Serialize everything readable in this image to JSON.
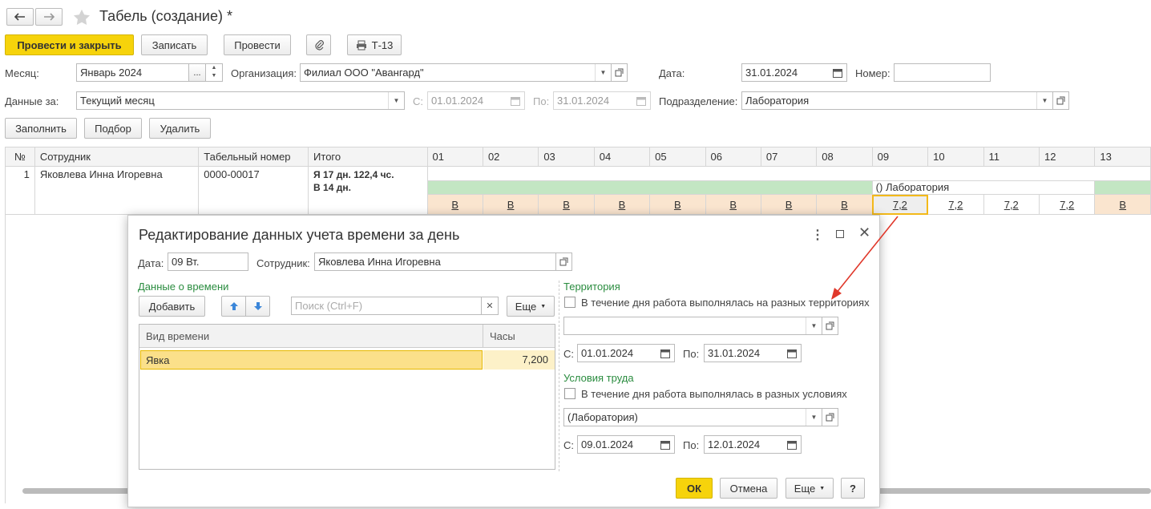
{
  "window": {
    "title": "Табель (создание) *"
  },
  "toolbar": {
    "post_close": "Провести и закрыть",
    "save": "Записать",
    "post": "Провести",
    "t13": "Т-13"
  },
  "form": {
    "month_label": "Месяц:",
    "month_value": "Январь 2024",
    "org_label": "Организация:",
    "org_value": "Филиал ООО \"Авангард\"",
    "date_label": "Дата:",
    "date_value": "31.01.2024",
    "number_label": "Номер:",
    "number_value": "",
    "data_for_label": "Данные за:",
    "data_for_value": "Текущий месяц",
    "from_label": "С:",
    "from_value": "01.01.2024",
    "to_label": "По:",
    "to_value": "31.01.2024",
    "dept_label": "Подразделение:",
    "dept_value": "Лаборатория"
  },
  "actions": {
    "fill": "Заполнить",
    "pick": "Подбор",
    "delete": "Удалить"
  },
  "grid": {
    "headers": {
      "num": "№",
      "employee": "Сотрудник",
      "tabnum": "Табельный номер",
      "total": "Итого"
    },
    "days": [
      "01",
      "02",
      "03",
      "04",
      "05",
      "06",
      "07",
      "08",
      "09",
      "10",
      "11",
      "12",
      "13"
    ],
    "row": {
      "num": "1",
      "employee": "Яковлева Инна Игоревна",
      "tabnum": "0000-00017",
      "total1": "Я 17 дн. 122,4 чс.",
      "total2": "В 14 дн.",
      "dept_note": "() Лаборатория",
      "cells": [
        "В",
        "В",
        "В",
        "В",
        "В",
        "В",
        "В",
        "В",
        "7,2",
        "7,2",
        "7,2",
        "7,2",
        "В"
      ]
    }
  },
  "dialog": {
    "title": "Редактирование данных учета времени за день",
    "date_label": "Дата:",
    "date_value": "09 Вт.",
    "employee_label": "Сотрудник:",
    "employee_value": "Яковлева Инна Игоревна",
    "time_section": "Данные о времени",
    "add": "Добавить",
    "search_placeholder": "Поиск (Ctrl+F)",
    "more": "Еще",
    "col_type": "Вид времени",
    "col_hours": "Часы",
    "row_type": "Явка",
    "row_hours": "7,200",
    "territory_section": "Территория",
    "territory_check": "В течение дня работа выполнялась на разных территориях",
    "territory_value": "",
    "t_from_label": "С:",
    "t_from": "01.01.2024",
    "t_to_label": "По:",
    "t_to": "31.01.2024",
    "cond_section": "Условия труда",
    "cond_check": "В течение дня работа выполнялась в разных условиях",
    "cond_value": "(Лаборатория)",
    "c_from_label": "С:",
    "c_from": "09.01.2024",
    "c_to_label": "По:",
    "c_to": "12.01.2024",
    "ok": "ОК",
    "cancel": "Отмена",
    "more2": "Еще",
    "help": "?"
  },
  "colors": {
    "accent": "#f6d30b",
    "green_bar": "#c3e6c3",
    "cell_bg": "#fae5cf",
    "selection": "#fbe08a",
    "arrow": "#e0382b"
  }
}
